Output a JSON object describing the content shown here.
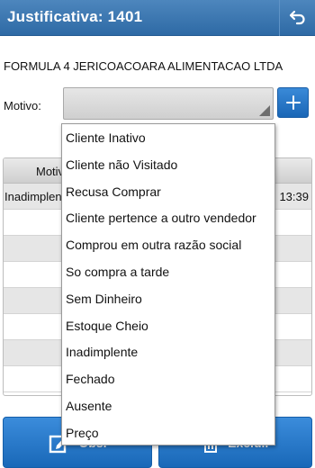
{
  "header": {
    "title": "Justificativa: 1401",
    "back_icon": "undo-arrow-icon"
  },
  "company": {
    "name": "FORMULA 4 JERICOACOARA ALIMENTACAO LTDA"
  },
  "motivo": {
    "label": "Motivo:",
    "selected_value": "",
    "add_icon": "plus-icon"
  },
  "table": {
    "header": {
      "col1": "Motivo"
    },
    "rows": [
      {
        "motivo": "Inadimplente",
        "hora": "13:39"
      }
    ]
  },
  "dropdown": {
    "options": [
      "Cliente Inativo",
      "Cliente não Visitado",
      "Recusa Comprar",
      "Cliente pertence a outro vendedor",
      "Comprou em outra razão social",
      "So compra a tarde",
      "Sem Dinheiro",
      "Estoque Cheio",
      "Inadimplente",
      "Fechado",
      "Ausente",
      "Preço"
    ]
  },
  "buttons": {
    "obs_label": "Obs.",
    "excluir_label": "Excluir"
  },
  "colors": {
    "accent": "#2e6aa5",
    "button": "#1a66b6"
  }
}
